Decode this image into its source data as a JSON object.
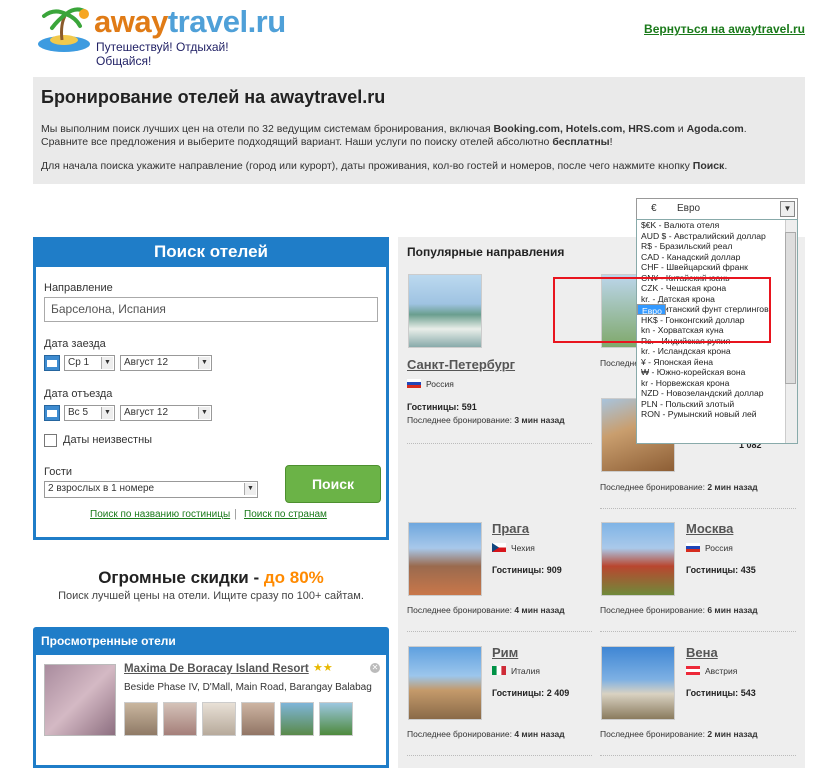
{
  "header": {
    "logo_text_1": "away",
    "logo_text_2": "travel.ru",
    "tagline": "Путешествуй! Отдыхай! Общайся!",
    "back_link": "Вернуться на awaytravel.ru"
  },
  "intro": {
    "title": "Бронирование отелей на awaytravel.ru",
    "p1_a": "Мы выполним поиск лучших цен на отели по 32 ведущим системам бронирования, включая ",
    "p1_b": "Booking.com, Hotels.com, HRS.com",
    "p1_c": " и ",
    "p1_d": "Agoda.com",
    "p1_e": ". Сравните все предложения и выберите подходящий вариант. Наши услуги по поиску отелей абсолютно ",
    "p1_f": "бесплатны",
    "p1_g": "!",
    "p2_a": "Для начала поиска укажите направление (город или курорт), даты проживания, кол-во гостей и номеров, после чего нажмите кнопку ",
    "p2_b": "Поиск",
    "p2_c": "."
  },
  "currency": {
    "symbol": "€",
    "selected": "Евро",
    "options": [
      "$€K - Валюта отеля",
      "AUD $ - Австралийский доллар",
      "R$ - Бразильский реал",
      "CAD - Канадский доллар",
      "CHF - Швейцарский франк",
      "CN¥ - Китайский юань",
      "CZK - Чешская крона",
      "kr. - Датская крона",
      "Евро",
      "£ - Британский фунт стерлингов",
      "HK$ - Гонконгский доллар",
      "kn - Хорватская куна",
      "Rs. - Индийская рупия",
      "kr. - Исландская крона",
      "¥ - Японская йена",
      "₩ - Южно-корейская вона",
      "kr - Норвежская крона",
      "NZD - Новозеландский доллар",
      "PLN - Польский злотый",
      "RON - Румынский новый лей"
    ],
    "selected_index": 8
  },
  "search": {
    "title": "Поиск отелей",
    "dest_label": "Направление",
    "dest_value": "Барселона, Испания",
    "checkin_label": "Дата заезда",
    "checkin_day": "Ср 1",
    "checkin_month": "Август 12",
    "checkout_label": "Дата отъезда",
    "checkout_day": "Вс 5",
    "checkout_month": "Август 12",
    "unknown_dates": "Даты неизвестны",
    "guests_label": "Гости",
    "guests_value": "2 взрослых в 1 номере",
    "button": "Поиск",
    "link_name": "Поиск по названию гостиницы",
    "link_country": "Поиск по странам",
    "link_sep": "|"
  },
  "discount": {
    "title_a": "Огромные скидки - ",
    "title_b": "до 80%",
    "sub": "Поиск лучшей цены на отели. Ищите сразу по 100+ сайтам."
  },
  "viewed": {
    "title": "Просмотренные отели",
    "hotel_name": "Maxima De Boracay Island Resort",
    "stars": "★★",
    "address": "Beside Phase IV, D'Mall, Main Road, Barangay Balabag"
  },
  "popular": {
    "title": "Популярные направления",
    "cities": [
      {
        "name": "Санкт-Петербург",
        "country": "Россия",
        "hotels_label": "Гостиницы:",
        "hotels": "591",
        "last_label": "Последнее бронирование:",
        "last": "3 мин назад"
      },
      {
        "name": "",
        "country": "",
        "hotels_label": "",
        "hotels": "",
        "last_label": "Последнее",
        "last": ""
      },
      {
        "name": "",
        "country": "",
        "hotels_label": "",
        "hotels": "1 082",
        "last_label": "Последнее бронирование:",
        "last": "2 мин назад"
      },
      {
        "name": "Прага",
        "country": "Чехия",
        "hotels_label": "Гостиницы:",
        "hotels": "909",
        "last_label": "Последнее бронирование:",
        "last": "4 мин назад"
      },
      {
        "name": "Москва",
        "country": "Россия",
        "hotels_label": "Гостиницы:",
        "hotels": "435",
        "last_label": "Последнее бронирование:",
        "last": "6 мин назад"
      },
      {
        "name": "Рим",
        "country": "Италия",
        "hotels_label": "Гостиницы:",
        "hotels": "2 409",
        "last_label": "Последнее бронирование:",
        "last": "4 мин назад"
      },
      {
        "name": "Вена",
        "country": "Австрия",
        "hotels_label": "Гостиницы:",
        "hotels": "543",
        "last_label": "Последнее бронирование:",
        "last": "2 мин назад"
      }
    ]
  },
  "colors": {
    "brand_blue": "#1f7dc8",
    "search_green": "#6bb347",
    "highlight_orange": "#ff8a00",
    "selection_blue": "#3399ff",
    "annotation_red": "#e8141e"
  }
}
